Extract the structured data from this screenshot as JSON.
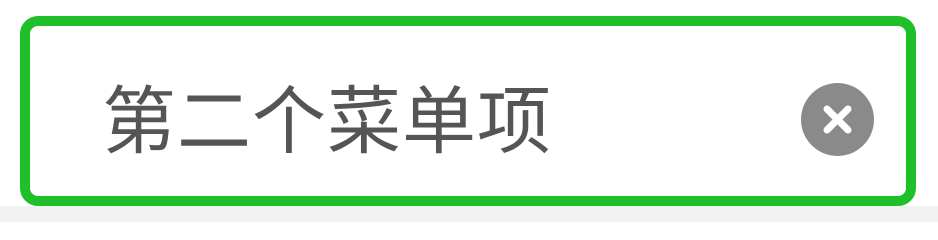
{
  "search": {
    "value": "第二个菜单项",
    "clear_icon": "close-icon"
  },
  "colors": {
    "border": "#1fbf2a",
    "text": "#555555",
    "clear_button": "#8a8a8a"
  }
}
